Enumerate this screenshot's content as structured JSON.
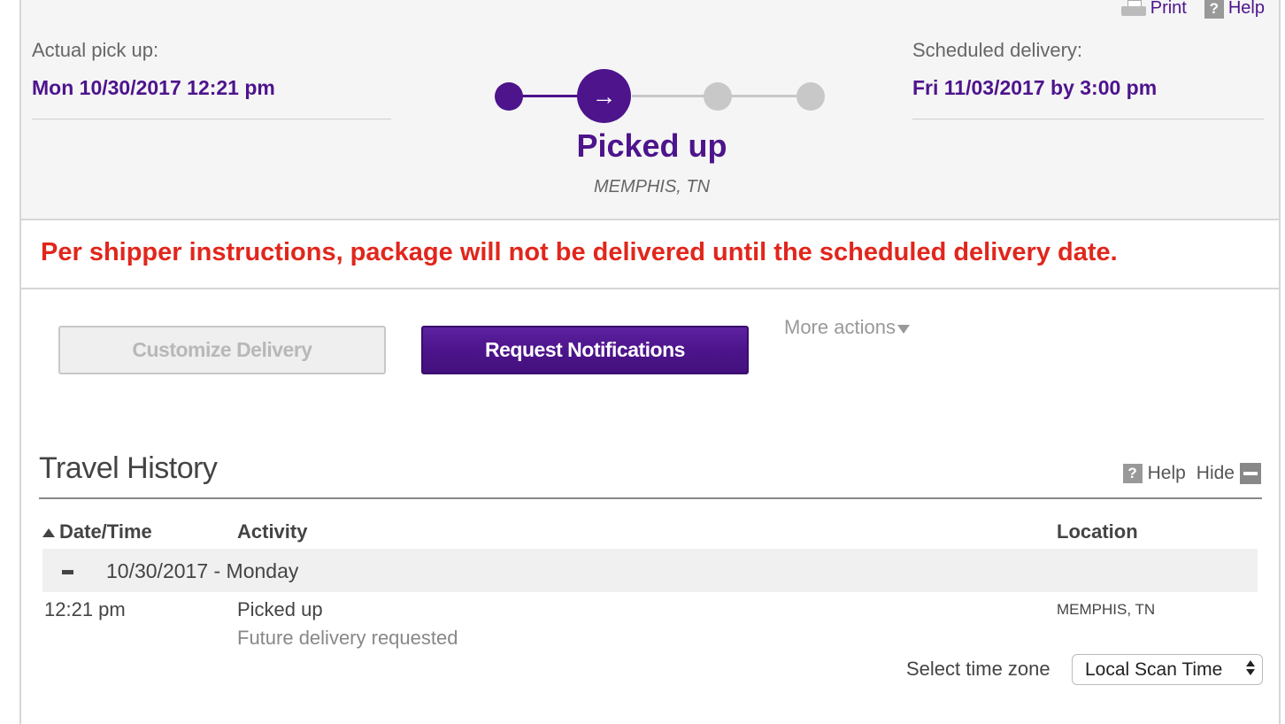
{
  "utility": {
    "print_label": "Print",
    "help_label": "Help",
    "help_icon_glyph": "?"
  },
  "pickup": {
    "label": "Actual pick up:",
    "value": "Mon 10/30/2017 12:21 pm"
  },
  "delivery": {
    "label": "Scheduled delivery:",
    "value": "Fri 11/03/2017 by 3:00 pm"
  },
  "progress": {
    "current_step": 2,
    "total_steps": 4,
    "arrow_glyph": "→"
  },
  "status": {
    "title": "Picked up",
    "location": "MEMPHIS, TN"
  },
  "alert": {
    "message": "Per shipper instructions, package will not be delivered until the scheduled delivery date."
  },
  "actions": {
    "customize_label": "Customize Delivery",
    "notify_label": "Request Notifications",
    "more_label": "More actions"
  },
  "travel_history": {
    "title": "Travel History",
    "help_label": "Help",
    "help_icon_glyph": "?",
    "hide_label": "Hide",
    "columns": {
      "datetime": "Date/Time",
      "activity": "Activity",
      "location": "Location"
    },
    "day_header": "10/30/2017 - Monday",
    "rows": [
      {
        "time": "12:21 pm",
        "activity": "Picked up",
        "detail": "Future delivery requested",
        "location": "MEMPHIS, TN"
      }
    ],
    "timezone_label": "Select time zone",
    "timezone_value": "Local Scan Time"
  },
  "colors": {
    "brand_purple": "#4d148c",
    "alert_red": "#e1261c",
    "inactive_dot": "#c8c8c8"
  }
}
